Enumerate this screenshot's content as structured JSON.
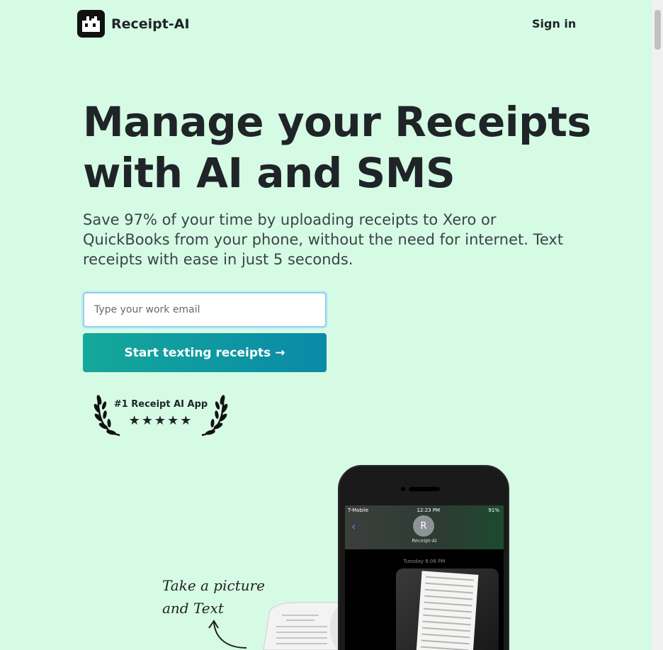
{
  "brand": {
    "name": "Receipt-AI",
    "logo_icon": "receipt-ai-logo-icon"
  },
  "nav": {
    "signin_label": "Sign in"
  },
  "hero": {
    "title_line1": "Manage your Receipts",
    "title_line2": "with AI and SMS",
    "subtitle": "Save 97% of your time by uploading receipts to Xero or QuickBooks from your phone, without the need for internet. Text receipts with ease in just 5 seconds."
  },
  "form": {
    "email_placeholder": "Type your work email",
    "email_value": "",
    "cta_label": "Start texting receipts",
    "cta_arrow": "→"
  },
  "award": {
    "label": "#1 Receipt AI App",
    "stars": "★★★★★",
    "rating": 5
  },
  "illustration": {
    "note_line1": "Take a picture",
    "note_line2": "and Text",
    "phone": {
      "carrier": "T-Mobile",
      "time": "12:23 PM",
      "battery": "91%",
      "contact_initial": "R",
      "contact_name": "Receipt-AI",
      "message_time": "Tuesday 8:08 PM"
    }
  },
  "colors": {
    "background": "#d6fbe4",
    "cta_gradient_start": "#14a89a",
    "cta_gradient_end": "#0a8aa7",
    "text": "#1f2428"
  }
}
